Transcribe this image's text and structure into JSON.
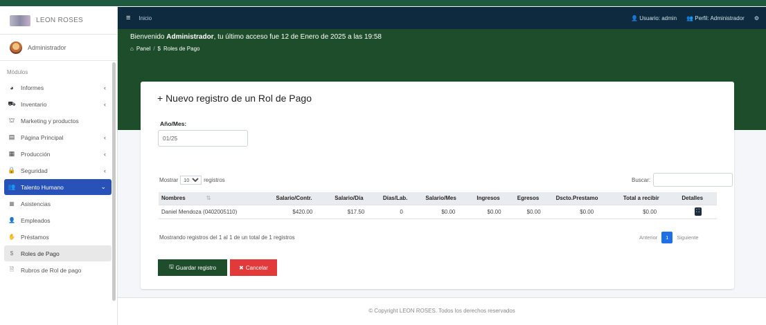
{
  "brand": {
    "name": "LEON ROSES"
  },
  "user": {
    "name": "Administrador"
  },
  "sidebar": {
    "section_label": "Módulos",
    "items": [
      {
        "label": "Informes",
        "icon": "pie-chart-icon",
        "glyph": "◕"
      },
      {
        "label": "Inventario",
        "icon": "dolly-icon",
        "glyph": "⛟"
      },
      {
        "label": "Marketing y productos",
        "icon": "shopping-basket-icon",
        "glyph": "⛫"
      },
      {
        "label": "Página Principal",
        "icon": "file-icon",
        "glyph": "▤"
      },
      {
        "label": "Producción",
        "icon": "calendar-icon",
        "glyph": "▦"
      },
      {
        "label": "Seguridad",
        "icon": "lock-icon",
        "glyph": "🔒"
      },
      {
        "label": "Talento Humano",
        "icon": "users-icon",
        "glyph": "👥"
      },
      {
        "label": "Asistencias",
        "icon": "table-icon",
        "glyph": "▦"
      },
      {
        "label": "Empleados",
        "icon": "user-icon",
        "glyph": "👤"
      },
      {
        "label": "Préstamos",
        "icon": "hand-icon",
        "glyph": "✋"
      },
      {
        "label": "Roles de Pago",
        "icon": "dollar-icon",
        "glyph": "$"
      },
      {
        "label": "Rubros de Rol de pago",
        "icon": "document-icon",
        "glyph": "🗎"
      }
    ]
  },
  "navbar": {
    "menu_glyph": "≡",
    "home_label": "Inicio",
    "user_label": "Usuario: admin",
    "profile_label": "Perfil: Administrador",
    "user_glyph": "👤",
    "profile_glyph": "👥",
    "gear_glyph": "⚙"
  },
  "header": {
    "welcome_prefix": "Bienvenido ",
    "welcome_name": "Administrador",
    "welcome_suffix": ", tu último acceso fue 12 de Enero de 2025 a las 19:58",
    "crumb_home": "Panel",
    "crumb_sep": "/",
    "crumb_current": "Roles de Pago",
    "crumb_home_glyph": "⌂",
    "crumb_current_glyph": "$"
  },
  "form": {
    "title": "+ Nuevo registro de un Rol de Pago",
    "anio_mes_label": "Año/Mes:",
    "anio_mes_value": "01/25"
  },
  "datatable": {
    "show_label": "Mostrar",
    "show_value": "10",
    "records_label": "registros",
    "search_label": "Buscar:",
    "columns": [
      "Nombres",
      "Salario/Contr.",
      "Salario/Día",
      "Días/Lab.",
      "Salario/Mes",
      "Ingresos",
      "Egresos",
      "Dscto.Prestamo",
      "Total a recibir",
      "Detalles"
    ],
    "sort_glyph": "⇅",
    "rows": [
      [
        "Daniel Mendoza (0402005110)",
        "$420.00",
        "$17.50",
        "0",
        "$0.00",
        "$0.00",
        "$0.00",
        "$0.00",
        "$0.00"
      ]
    ],
    "detail_glyph": "⛶",
    "info": "Mostrando registros del 1 al 1 de un total de 1 registros",
    "prev_label": "Anterior",
    "page": "1",
    "next_label": "Siguiente"
  },
  "buttons": {
    "save_label": "Guardar registro",
    "save_glyph": "🖫",
    "cancel_label": "Cancelar",
    "cancel_glyph": "✖"
  },
  "footer": {
    "text": "© Copyright LEON ROSES. Todos los derechos reservados"
  },
  "colors": {
    "header_green": "#1e4d2b",
    "navbar_dark": "#0e2a3e",
    "active_blue": "#2852b8",
    "cancel_red": "#e23a3a",
    "page_blue": "#1e6fe8"
  }
}
